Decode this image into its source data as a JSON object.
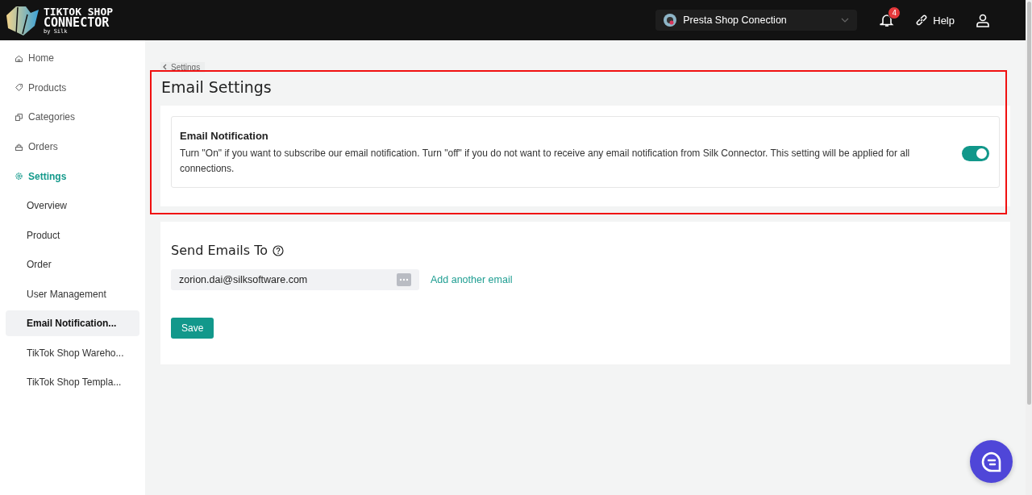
{
  "header": {
    "logo_title": "TIKTOK SHOP",
    "logo_subtitle": "CONNECTOR",
    "logo_tagline": "by Silk",
    "connection": "Presta Shop Conection",
    "notification_count": "4",
    "help": "Help"
  },
  "sidebar": {
    "items": [
      {
        "kind": "nav",
        "label": "Home",
        "selected": false
      },
      {
        "kind": "nav",
        "label": "Products",
        "selected": false
      },
      {
        "kind": "nav",
        "label": "Categories",
        "selected": false
      },
      {
        "kind": "nav",
        "label": "Orders",
        "selected": false
      },
      {
        "kind": "nav",
        "label": "Settings",
        "selected": true
      },
      {
        "kind": "sub",
        "label": "Overview",
        "selected": false
      },
      {
        "kind": "sub",
        "label": "Product",
        "selected": false
      },
      {
        "kind": "sub",
        "label": "Order",
        "selected": false
      },
      {
        "kind": "sub",
        "label": "User Management",
        "selected": false
      },
      {
        "kind": "sub",
        "label": "Email Notification...",
        "selected": true
      },
      {
        "kind": "sub",
        "label": "TikTok Shop Wareho...",
        "selected": false
      },
      {
        "kind": "sub",
        "label": "TikTok Shop Templa...",
        "selected": false
      }
    ]
  },
  "breadcrumb": "Settings",
  "page_title": "Email Settings",
  "notification": {
    "title": "Email Notification",
    "description": "Turn \"On\" if you want to subscribe our email notification. Turn \"off\" if you do not want to receive any email notification from Silk Connector. This setting will be applied for all connections.",
    "on": true
  },
  "recipients": {
    "title": "Send Emails To",
    "emails": [
      "zorion.dai@silksoftware.com"
    ],
    "add_link": "Add another email"
  },
  "save_button": "Save"
}
